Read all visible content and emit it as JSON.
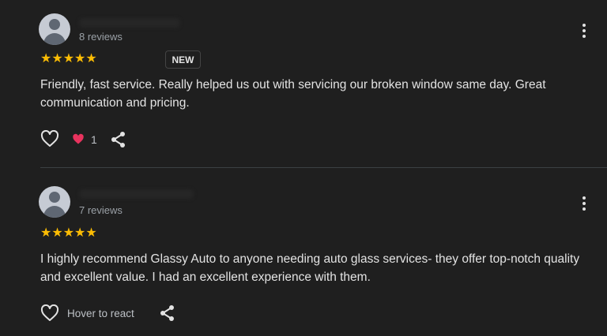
{
  "reviews": [
    {
      "review_count": "8 reviews",
      "stars": "★★★★★",
      "badge": "NEW",
      "text": "Friendly, fast service. Really helped us out with servicing our broken window same day. Great communication and pricing.",
      "reaction_emoji": "heart",
      "reaction_count": "1"
    },
    {
      "review_count": "7 reviews",
      "stars": "★★★★★",
      "text": "I highly recommend Glassy Auto to anyone needing auto glass services- they offer top-notch quality and excellent value. I had an excellent experience with them.",
      "hover_label": "Hover to react"
    }
  ],
  "colors": {
    "star": "#fbbc04",
    "heart": "#e8335e",
    "background": "#1f1f1f"
  }
}
